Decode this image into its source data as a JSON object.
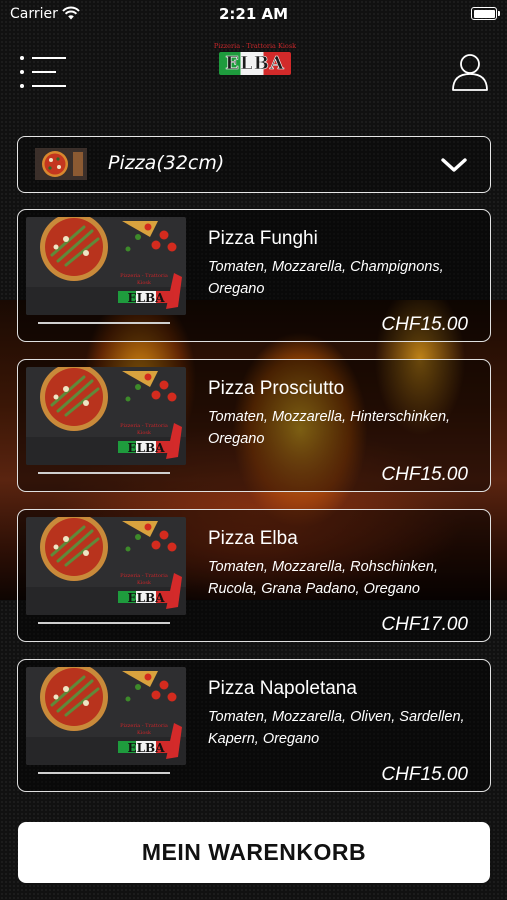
{
  "status_bar": {
    "carrier": "Carrier",
    "time": "2:21 AM"
  },
  "header": {
    "logo_tagline": "Pizzeria - Trattoria Kiosk",
    "logo_text": "ELBA",
    "menu_icon": "hamburger-menu-icon",
    "user_icon": "user-icon"
  },
  "category": {
    "selected": "Pizza(32cm)",
    "icon": "chevron-down-icon"
  },
  "products": [
    {
      "name": "Pizza Funghi",
      "description": "Tomaten, Mozzarella, Champignons, Oregano",
      "price": "CHF15.00"
    },
    {
      "name": "Pizza Prosciutto",
      "description": "Tomaten, Mozzarella, Hinterschinken, Oregano",
      "price": "CHF15.00"
    },
    {
      "name": "Pizza Elba",
      "description": "Tomaten, Mozzarella, Rohschinken, Rucola, Grana Padano, Oregano",
      "price": "CHF17.00"
    },
    {
      "name": "Pizza Napoletana",
      "description": "Tomaten, Mozzarella, Oliven, Sardellen, Kapern, Oregano",
      "price": "CHF15.00"
    }
  ],
  "cart_button": {
    "label": "MEIN WARENKORB"
  },
  "colors": {
    "background": "#111111",
    "accent_red": "#d22a2a",
    "accent_green": "#1e9b3d",
    "card_border": "#e0e0e0"
  }
}
